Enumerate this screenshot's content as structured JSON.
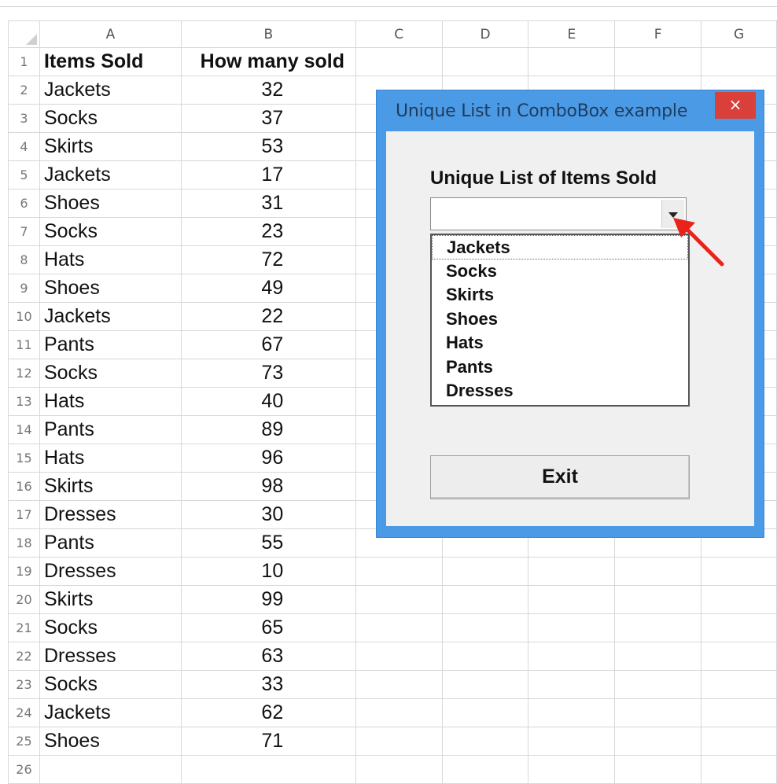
{
  "columns": [
    "A",
    "B",
    "C",
    "D",
    "E",
    "F",
    "G"
  ],
  "header_row": {
    "row": "1",
    "a": "Items Sold",
    "b": "How many sold"
  },
  "rows": [
    {
      "row": "2",
      "a": "Jackets",
      "b": "32"
    },
    {
      "row": "3",
      "a": "Socks",
      "b": "37"
    },
    {
      "row": "4",
      "a": "Skirts",
      "b": "53"
    },
    {
      "row": "5",
      "a": "Jackets",
      "b": "17"
    },
    {
      "row": "6",
      "a": "Shoes",
      "b": "31"
    },
    {
      "row": "7",
      "a": "Socks",
      "b": "23"
    },
    {
      "row": "8",
      "a": "Hats",
      "b": "72"
    },
    {
      "row": "9",
      "a": "Shoes",
      "b": "49"
    },
    {
      "row": "10",
      "a": "Jackets",
      "b": "22"
    },
    {
      "row": "11",
      "a": "Pants",
      "b": "67"
    },
    {
      "row": "12",
      "a": "Socks",
      "b": "73"
    },
    {
      "row": "13",
      "a": "Hats",
      "b": "40"
    },
    {
      "row": "14",
      "a": "Pants",
      "b": "89"
    },
    {
      "row": "15",
      "a": "Hats",
      "b": "96"
    },
    {
      "row": "16",
      "a": "Skirts",
      "b": "98"
    },
    {
      "row": "17",
      "a": "Dresses",
      "b": "30"
    },
    {
      "row": "18",
      "a": "Pants",
      "b": "55"
    },
    {
      "row": "19",
      "a": "Dresses",
      "b": "10"
    },
    {
      "row": "20",
      "a": "Skirts",
      "b": "99"
    },
    {
      "row": "21",
      "a": "Socks",
      "b": "65"
    },
    {
      "row": "22",
      "a": "Dresses",
      "b": "63"
    },
    {
      "row": "23",
      "a": "Socks",
      "b": "33"
    },
    {
      "row": "24",
      "a": "Jackets",
      "b": "62"
    },
    {
      "row": "25",
      "a": "Shoes",
      "b": "71"
    },
    {
      "row": "26",
      "a": "",
      "b": ""
    }
  ],
  "dialog": {
    "title": "Unique List in ComboBox example",
    "close_icon": "×",
    "list_label": "Unique List of Items Sold",
    "combo_value": "",
    "list_items": [
      "Jackets",
      "Socks",
      "Skirts",
      "Shoes",
      "Hats",
      "Pants",
      "Dresses"
    ],
    "exit_label": "Exit"
  },
  "annotation": {
    "arrow_color": "#e8231b"
  },
  "colors": {
    "dialog_frame": "#4b9ae6",
    "close_button": "#d9403a",
    "dialog_body": "#f0f0f0"
  }
}
